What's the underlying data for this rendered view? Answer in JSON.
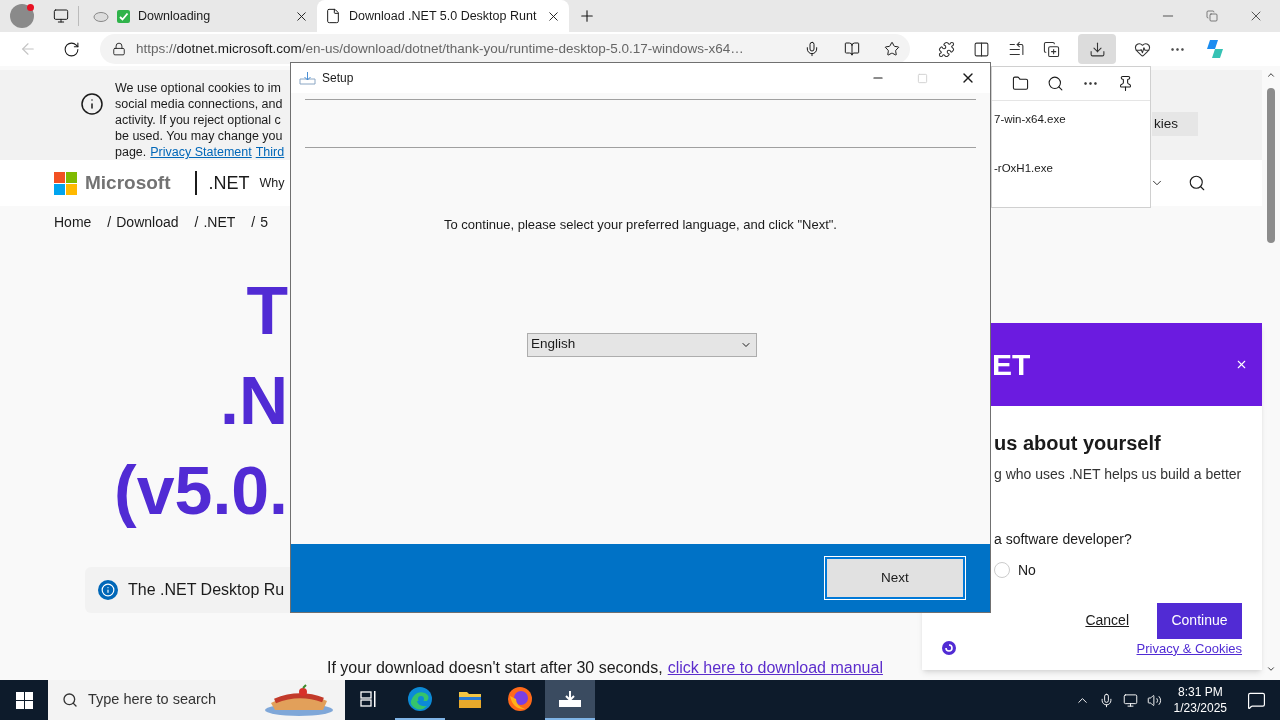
{
  "browser": {
    "tabs": [
      {
        "title": "Downloading",
        "selected": false
      },
      {
        "title": "Download .NET 5.0 Desktop Runt",
        "selected": true
      }
    ],
    "back_disabled": true,
    "address": {
      "scheme": "https://",
      "host": "dotnet.microsoft.com",
      "path": "/en-us/download/dotnet/thank-you/runtime-desktop-5.0.17-windows-x64…"
    },
    "downloads_active": true
  },
  "page": {
    "cookie_lines": [
      "We use optional cookies to im",
      "social media connections, and",
      "activity. If you reject optional c",
      "be used. You may change you"
    ],
    "cookie_last": "page.",
    "cookie_links": [
      "Privacy Statement",
      "Third"
    ],
    "cookie_button": "kies",
    "brand": "Microsoft",
    "product": ".NET",
    "nav_item": "Why",
    "breadcrumb": [
      {
        "label": "Home"
      },
      {
        "sep": "/",
        "label": "Download"
      },
      {
        "sep": "/",
        "label": ".NET"
      },
      {
        "sep": "/",
        "label": "5"
      }
    ],
    "heading_lines": [
      "T",
      ".N",
      "(v5.0."
    ],
    "info": "The .NET Desktop Ru",
    "note": {
      "text": "If your download doesn't start after 30 seconds,",
      "link": "click here to download manual"
    }
  },
  "downloads_flyout": {
    "files": [
      "7-win-x64.exe",
      "-rOxH1.exe"
    ]
  },
  "survey": {
    "header": "ET",
    "heading": "us about yourself",
    "intro": "g who uses .NET helps us build a better",
    "question": "a software developer?",
    "options": [
      {
        "label": "No",
        "selected": false
      }
    ],
    "cancel": "Cancel",
    "continue": "Continue",
    "privacy": "Privacy & Cookies"
  },
  "dialog": {
    "title": "Setup",
    "maximize_disabled": true,
    "prompt": "To continue, please select your preferred language, and click \"Next\".",
    "language": "English",
    "next": "Next"
  },
  "taskbar": {
    "search_placeholder": "Type here to search",
    "apps": [
      {
        "kind": "task-view",
        "running": false,
        "active": false
      },
      {
        "kind": "edge",
        "running": true,
        "active": false
      },
      {
        "kind": "explorer",
        "running": false,
        "active": false
      },
      {
        "kind": "firefox",
        "running": false,
        "active": false
      },
      {
        "kind": "setup",
        "running": true,
        "active": true
      }
    ],
    "time": "8:31 PM",
    "date": "1/23/2025"
  }
}
